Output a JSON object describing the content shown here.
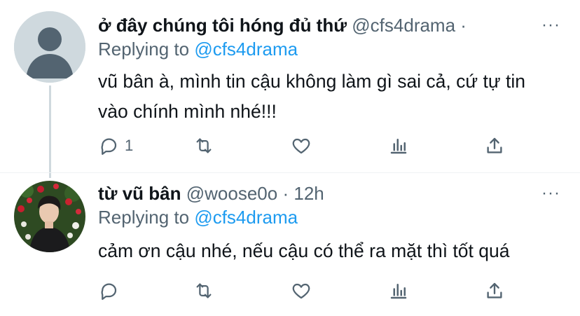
{
  "tweets": [
    {
      "display_name": "ở đây chúng tôi hóng đủ thứ",
      "handle": "@cfs4drama",
      "separator": "·",
      "time": "",
      "more": "···",
      "replying_prefix": "Replying to ",
      "replying_handle": "@cfs4drama",
      "body": "vũ bân à, mình tin cậu không làm gì sai cả, cứ tự tin vào chính mình nhé!!!",
      "reply_count": "1",
      "avatar": "default-avatar-icon"
    },
    {
      "display_name": "từ vũ bân",
      "handle": "@woose0o",
      "separator": "·",
      "time": "12h",
      "more": "···",
      "replying_prefix": "Replying to ",
      "replying_handle": "@cfs4drama",
      "body": "cảm ơn cậu nhé, nếu cậu có thể ra mặt thì tốt quá",
      "reply_count": "",
      "avatar": "profile-photo"
    }
  ],
  "colors": {
    "text": "#0f1419",
    "muted": "#536471",
    "link": "#1d9bf0",
    "thread_line": "#cfd9de"
  }
}
